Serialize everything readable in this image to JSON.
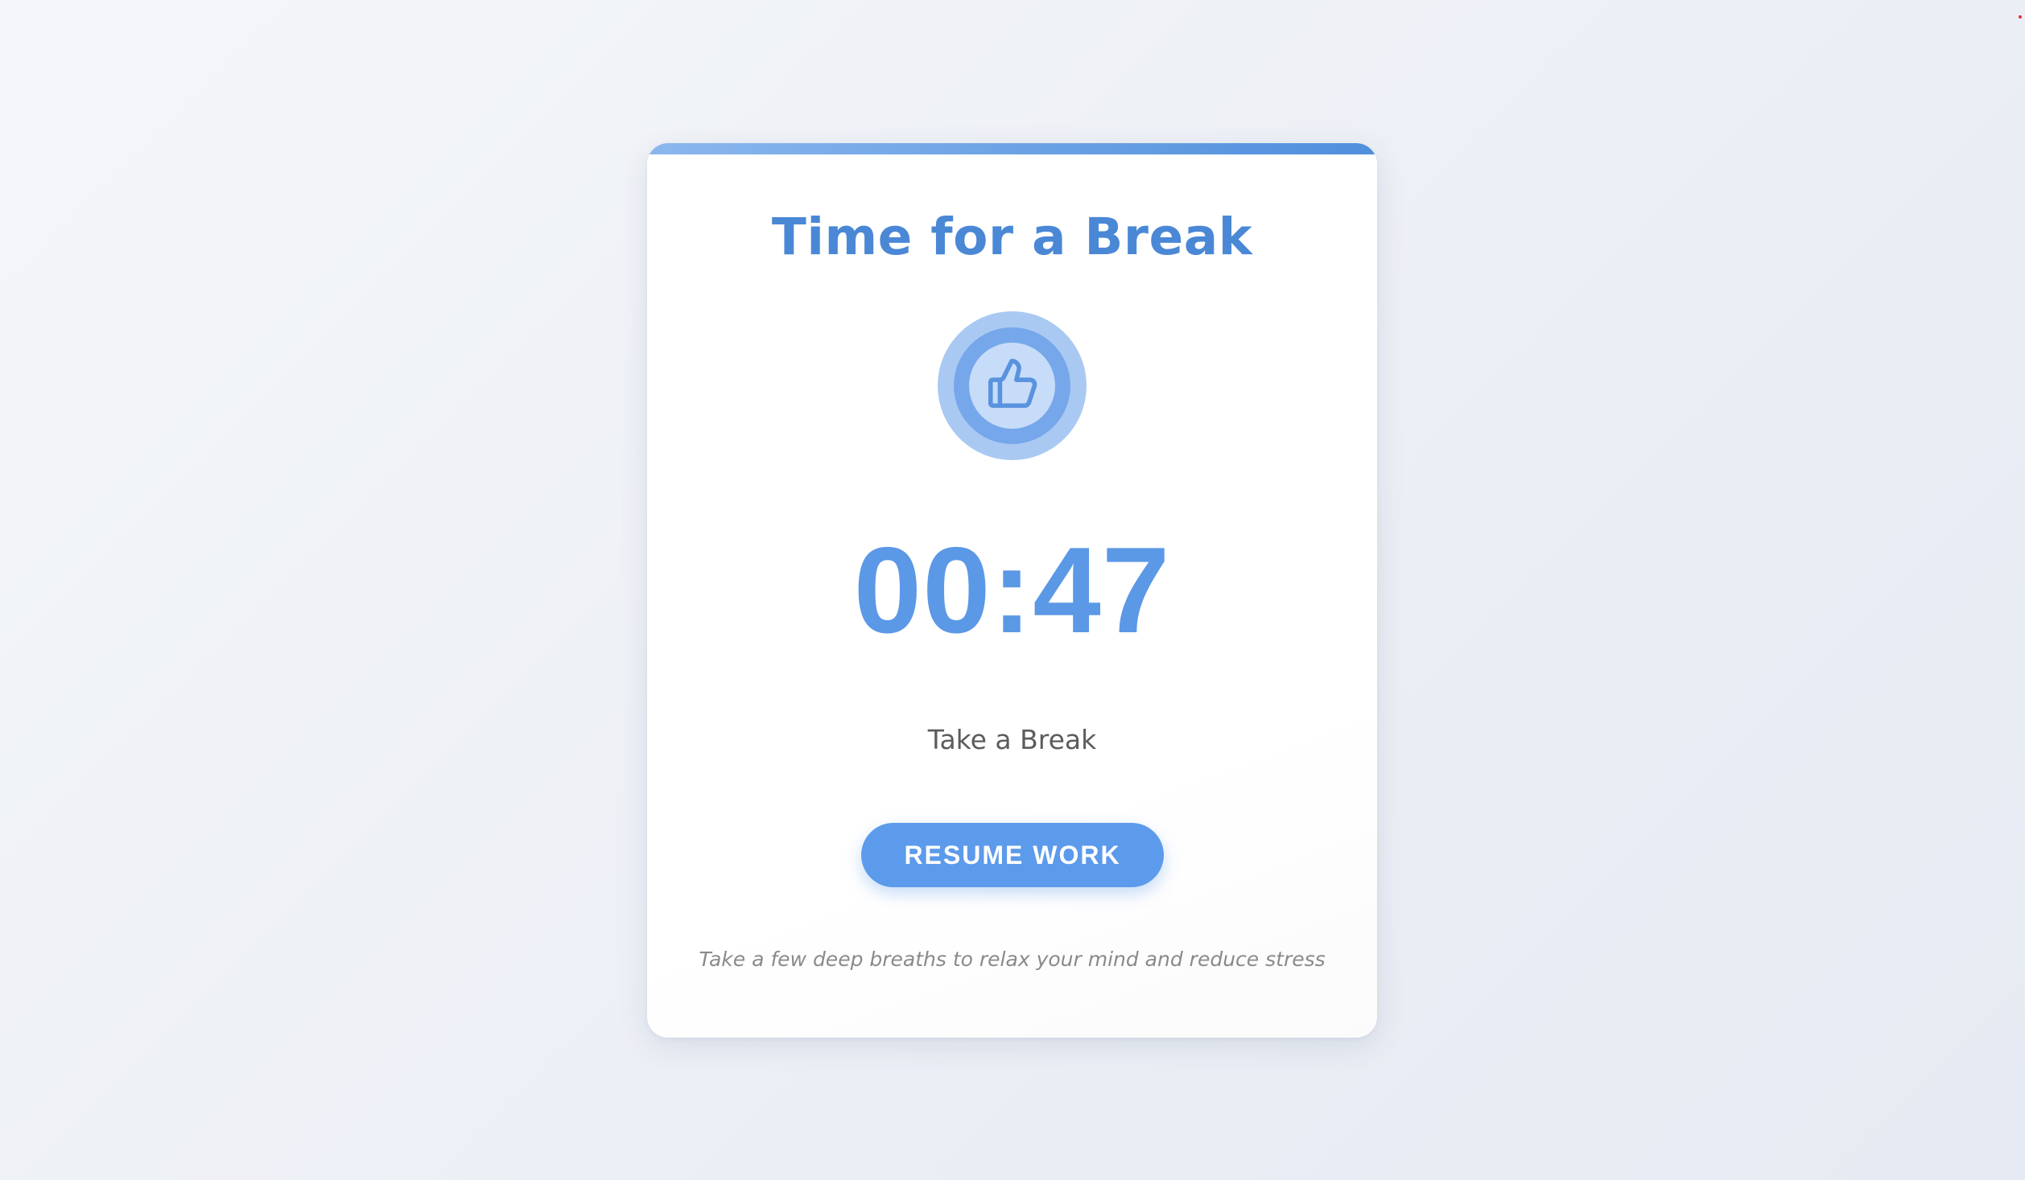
{
  "card": {
    "title": "Time for a Break",
    "icon": "thumbs-up-icon",
    "timer": "00:47",
    "status": "Take a Break",
    "resume_label": "RESUME WORK",
    "tip": "Take a few deep breaths to relax your mind and reduce stress"
  },
  "colors": {
    "accent": "#4a88d6",
    "timer": "#5b98e6",
    "button": "#5c9aeb",
    "icon_outer": "#a9c9f3",
    "icon_ring": "#76a7ea",
    "icon_core": "#c6dcf8"
  }
}
